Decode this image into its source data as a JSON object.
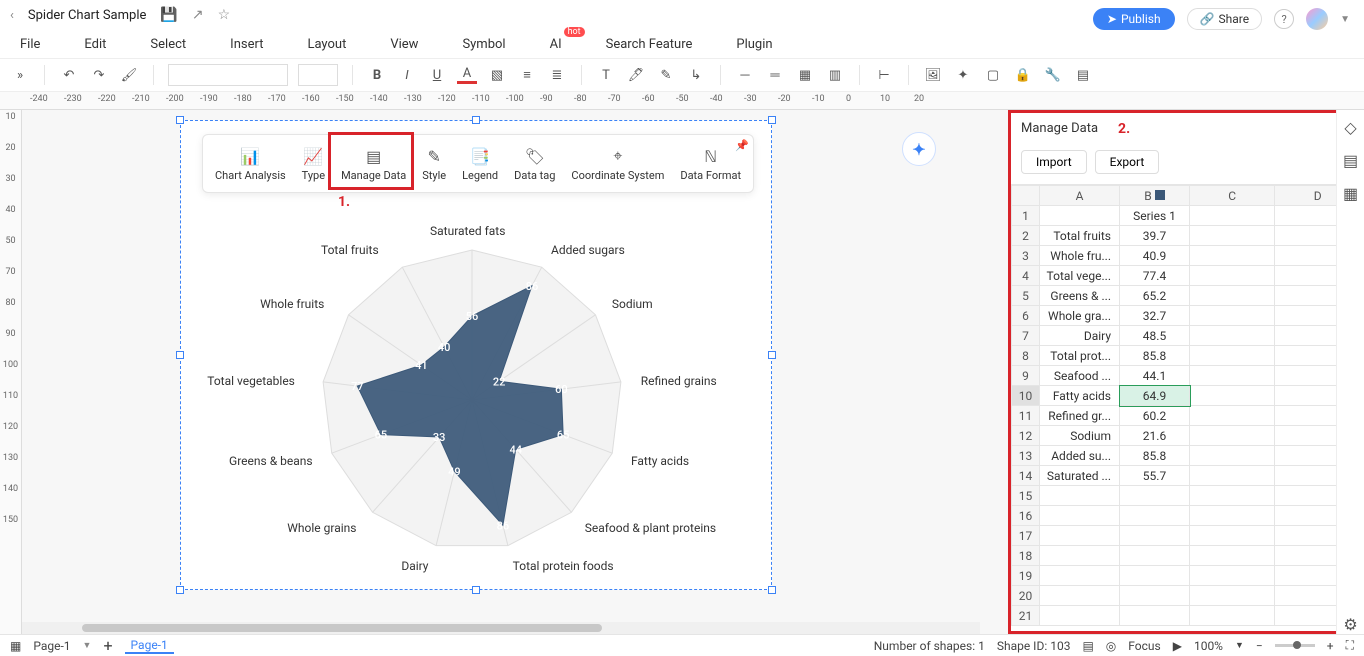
{
  "titlebar": {
    "title": "Spider Chart Sample"
  },
  "menu": {
    "file": "File",
    "edit": "Edit",
    "select": "Select",
    "insert": "Insert",
    "layout": "Layout",
    "view": "View",
    "symbol": "Symbol",
    "ai": "AI",
    "ai_hot": "hot",
    "search": "Search Feature",
    "plugin": "Plugin"
  },
  "actions": {
    "publish": "Publish",
    "share": "Share"
  },
  "float_toolbar": {
    "chart_analysis": "Chart Analysis",
    "type": "Type",
    "manage_data": "Manage Data",
    "style": "Style",
    "legend": "Legend",
    "data_tag": "Data tag",
    "coord": "Coordinate System",
    "data_format": "Data Format"
  },
  "annotations": {
    "one": "1.",
    "two": "2."
  },
  "rightpanel": {
    "title": "Manage Data",
    "import": "Import",
    "export": "Export",
    "cols": [
      "A",
      "B",
      "C",
      "D"
    ],
    "header_row": [
      "",
      "Series 1",
      "",
      ""
    ],
    "rows": [
      [
        "Total fruits",
        "39.7"
      ],
      [
        "Whole fru...",
        "40.9"
      ],
      [
        "Total vege...",
        "77.4"
      ],
      [
        "Greens & ...",
        "65.2"
      ],
      [
        "Whole gra...",
        "32.7"
      ],
      [
        "Dairy",
        "48.5"
      ],
      [
        "Total prot...",
        "85.8"
      ],
      [
        "Seafood ...",
        "44.1"
      ],
      [
        "Fatty acids",
        "64.9"
      ],
      [
        "Refined gr...",
        "60.2"
      ],
      [
        "Sodium",
        "21.6"
      ],
      [
        "Added su...",
        "85.8"
      ],
      [
        "Saturated ...",
        "55.7"
      ]
    ],
    "selected_row_index": 8
  },
  "status": {
    "page_label": "Page-1",
    "tab": "Page-1",
    "shapes": "Number of shapes: 1",
    "shapeid": "Shape ID: 103",
    "focus": "Focus",
    "zoom": "100%"
  },
  "chart_data": {
    "type": "radar",
    "title": "",
    "categories": [
      "Saturated fats",
      "Added sugars",
      "Sodium",
      "Refined grains",
      "Fatty acids",
      "Seafood & plant proteins",
      "Total protein foods",
      "Dairy",
      "Whole grains",
      "Greens & beans",
      "Total vegetables",
      "Whole fruits",
      "Total fruits"
    ],
    "series": [
      {
        "name": "Series 1",
        "values": [
          56,
          86,
          22,
          60,
          65,
          44,
          86,
          49,
          33,
          65,
          77,
          41,
          40
        ],
        "color": "#3b5878"
      }
    ],
    "value_range": [
      0,
      100
    ],
    "rings": 5
  },
  "ruler_h": [
    -240,
    -230,
    -220,
    -210,
    -200,
    -190,
    -180,
    -170,
    -160,
    -150,
    -140,
    -130,
    -120,
    -110,
    -100,
    -90,
    -80,
    -70,
    -60,
    -50,
    -40,
    -30,
    -20,
    -10,
    0,
    10,
    20
  ],
  "ruler_v": [
    10,
    20,
    30,
    40,
    50,
    70,
    80,
    90,
    100,
    110,
    120,
    130,
    140,
    150
  ]
}
